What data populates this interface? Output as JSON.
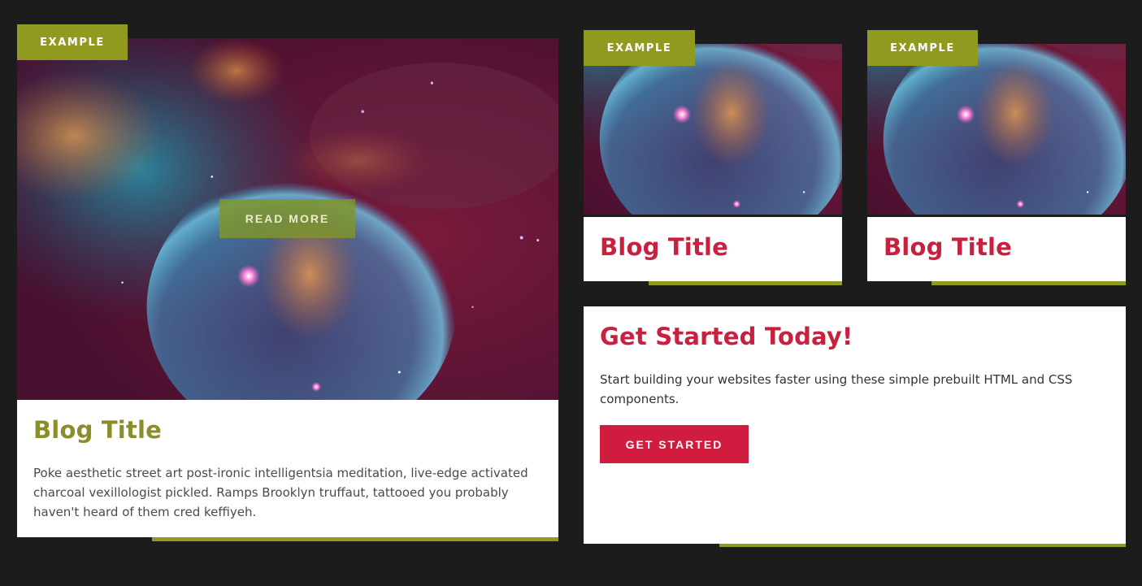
{
  "colors": {
    "background": "#1c1c1c",
    "accent_olive": "#909a1f",
    "title_olive": "#8b8d2a",
    "title_crimson": "#c8203f",
    "button_crimson": "#cf1c3f",
    "card_white": "#ffffff",
    "body_text": "#4a4a4a"
  },
  "featured_card": {
    "tag": "EXAMPLE",
    "image": "nebula-bubble-image",
    "overlay_button": "READ MORE",
    "title": "Blog Title",
    "excerpt": "Poke aesthetic street art post-ironic intelligentsia meditation, live-edge activated charcoal vexillologist pickled. Ramps Brooklyn truffaut, tattooed you probably haven't heard of them cred keffiyeh."
  },
  "small_cards": [
    {
      "tag": "EXAMPLE",
      "image": "nebula-bubble-image",
      "title": "Blog Title"
    },
    {
      "tag": "EXAMPLE",
      "image": "nebula-bubble-image",
      "title": "Blog Title"
    }
  ],
  "cta_card": {
    "heading": "Get Started Today!",
    "text": "Start building your websites faster using these simple prebuilt HTML and CSS components.",
    "button": "GET STARTED"
  }
}
